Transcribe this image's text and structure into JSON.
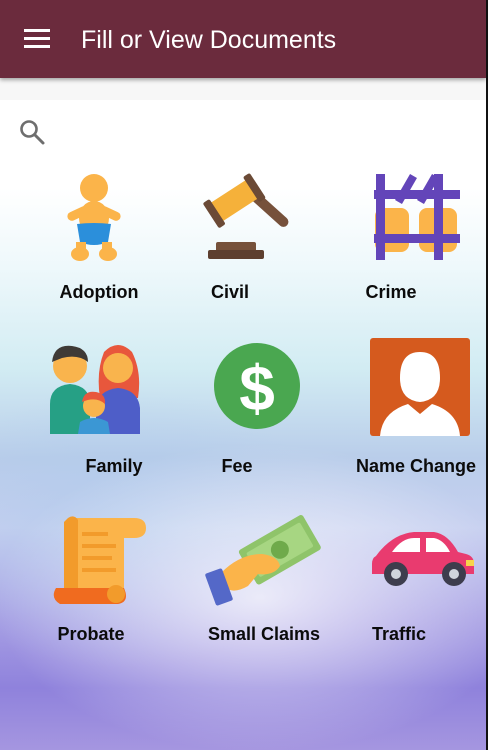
{
  "appbar": {
    "title": "Fill or View Documents",
    "menu_icon": "hamburger-menu-icon",
    "color": "#6b2b3d"
  },
  "search": {
    "icon": "search-icon"
  },
  "categories": [
    {
      "label": "Adoption",
      "icon": "baby-icon"
    },
    {
      "label": "Civil",
      "icon": "gavel-icon"
    },
    {
      "label": "Crime",
      "icon": "jail-bars-icon"
    },
    {
      "label": "Family",
      "icon": "family-icon"
    },
    {
      "label": "Fee",
      "icon": "dollar-coin-icon"
    },
    {
      "label": "Name Change",
      "icon": "person-silhouette-icon"
    },
    {
      "label": "Probate",
      "icon": "scroll-icon"
    },
    {
      "label": "Small Claims",
      "icon": "money-hand-icon"
    },
    {
      "label": "Traffic",
      "icon": "car-icon"
    }
  ]
}
